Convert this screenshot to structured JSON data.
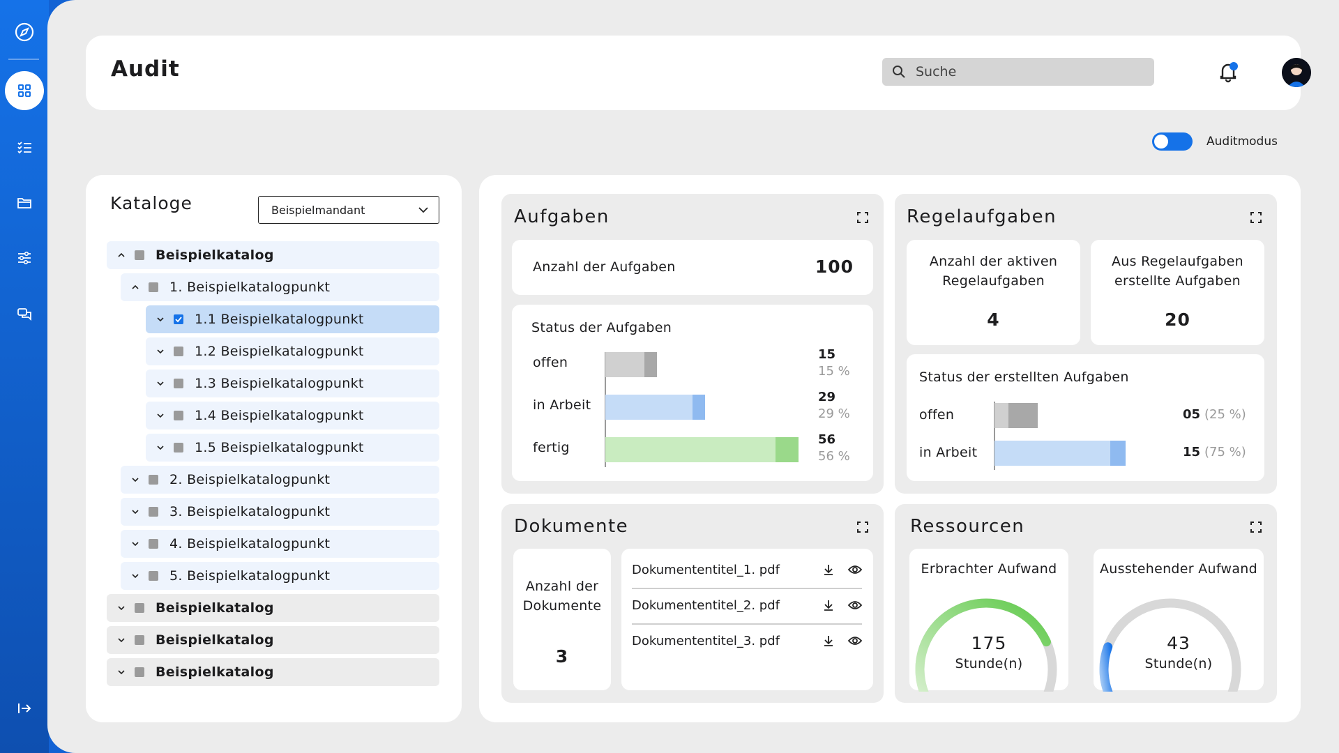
{
  "header": {
    "title": "Audit",
    "search_placeholder": "Suche"
  },
  "audit_mode": {
    "label": "Auditmodus",
    "enabled": true
  },
  "catalog": {
    "title": "Kataloge",
    "client_select": "Beispielmandant",
    "items": [
      {
        "label": "Beispielkatalog",
        "level": 0,
        "expanded": true
      },
      {
        "label": "1. Beispielkatalogpunkt",
        "level": 1,
        "expanded": true
      },
      {
        "label": "1.1 Beispielkatalogpunkt",
        "level": 2,
        "checked": true,
        "selected": true
      },
      {
        "label": "1.2 Beispielkatalogpunkt",
        "level": 2
      },
      {
        "label": "1.3 Beispielkatalogpunkt",
        "level": 2
      },
      {
        "label": "1.4 Beispielkatalogpunkt",
        "level": 2
      },
      {
        "label": "1.5 Beispielkatalogpunkt",
        "level": 2
      },
      {
        "label": "2. Beispielkatalogpunkt",
        "level": 1
      },
      {
        "label": "3. Beispielkatalogpunkt",
        "level": 1
      },
      {
        "label": "4. Beispielkatalogpunkt",
        "level": 1
      },
      {
        "label": "5. Beispielkatalogpunkt",
        "level": 1
      },
      {
        "label": "Beispielkatalog",
        "level": 0
      },
      {
        "label": "Beispielkatalog",
        "level": 0
      },
      {
        "label": "Beispielkatalog",
        "level": 0
      }
    ]
  },
  "aufgaben": {
    "title": "Aufgaben",
    "count_label": "Anzahl der Aufgaben",
    "count_value": "100",
    "status_title": "Status der Aufgaben",
    "statuses": [
      {
        "label": "offen",
        "value": "15",
        "pct": "15 %",
        "fraction": 0.15,
        "color": "#d0d0d0",
        "cap": "#a8a8a8"
      },
      {
        "label": "in Arbeit",
        "value": "29",
        "pct": "29 %",
        "fraction": 0.29,
        "color": "#c5dcf7",
        "cap": "#8fbaf0"
      },
      {
        "label": "fertig",
        "value": "56",
        "pct": "56 %",
        "fraction": 0.56,
        "color": "#c9ecc0",
        "cap": "#9ad98a"
      }
    ]
  },
  "regelaufgaben": {
    "title": "Regelaufgaben",
    "active_label_1": "Anzahl der aktiven",
    "active_label_2": "Regelaufgaben",
    "active_value": "4",
    "created_label_1": "Aus Regelaufgaben",
    "created_label_2": "erstellte Aufgaben",
    "created_value": "20",
    "status_title": "Status der erstellten Aufgaben",
    "statuses": [
      {
        "label": "offen",
        "value": "05",
        "pct": "(25 %)",
        "fraction": 0.25,
        "color": "#d0d0d0",
        "cap": "#a8a8a8"
      },
      {
        "label": "in Arbeit",
        "value": "15",
        "pct": "(75 %)",
        "fraction": 0.75,
        "color": "#c5dcf7",
        "cap": "#8fbaf0"
      }
    ]
  },
  "dokumente": {
    "title": "Dokumente",
    "count_label_1": "Anzahl der",
    "count_label_2": "Dokumente",
    "count_value": "3",
    "files": [
      "Dokumententitel_1. pdf",
      "Dokumententitel_2. pdf",
      "Dokumententitel_3. pdf"
    ]
  },
  "ressourcen": {
    "title": "Ressourcen",
    "gauges": [
      {
        "label": "Erbrachter Aufwand",
        "value": "175",
        "unit": "Stunde(n)",
        "fraction": 0.78,
        "color": "#5fc94a"
      },
      {
        "label": "Ausstehender Aufwand",
        "value": "43",
        "unit": "Stunde(n)",
        "fraction": 0.2,
        "color": "#1572e8"
      }
    ]
  },
  "colors": {
    "brand": "#1572e8",
    "accent_green": "#5fc94a",
    "notification_dot": "#1572e8"
  },
  "icons": [
    "compass-icon",
    "dashboard-icon",
    "checklist-icon",
    "folder-icon",
    "sliders-icon",
    "chat-icon",
    "logout-icon",
    "search-icon",
    "bell-icon",
    "avatar-icon",
    "expand-icon",
    "download-icon",
    "eye-icon"
  ]
}
